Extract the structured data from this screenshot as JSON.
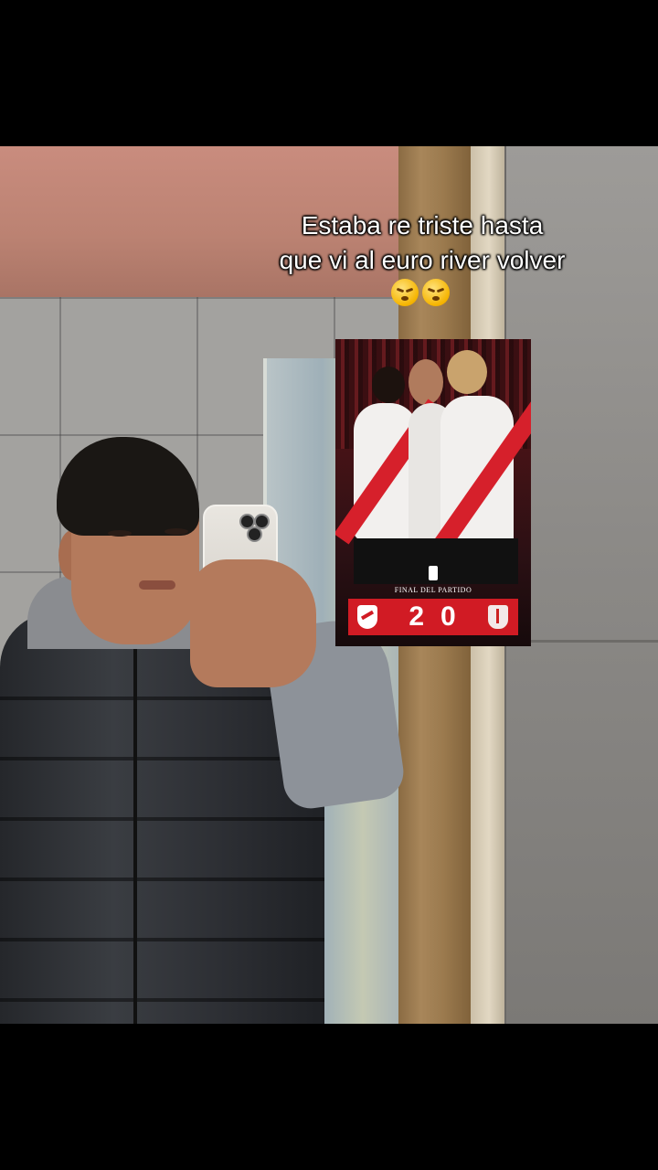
{
  "caption": {
    "line1": "Estaba re triste hasta",
    "line2": "que vi al euro river volver",
    "emojis": [
      "weary-face-emoji",
      "weary-face-emoji"
    ]
  },
  "match_card": {
    "label": "FINAL DEL PARTIDO",
    "home_score": "2",
    "away_score": "0",
    "home_badge": "river-plate-badge",
    "away_badge": "opponent-badge",
    "accent_color": "#d11b24"
  }
}
